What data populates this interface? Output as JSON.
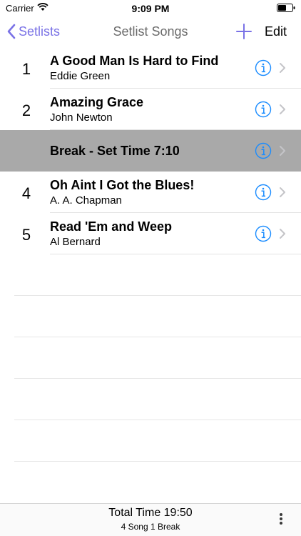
{
  "status_bar": {
    "carrier": "Carrier",
    "time": "9:09 PM"
  },
  "nav": {
    "back_label": "Setlists",
    "title": "Setlist Songs",
    "edit_label": "Edit"
  },
  "songs": [
    {
      "number": "1",
      "title": "A Good Man Is Hard to Find",
      "artist": "Eddie Green",
      "selected": false
    },
    {
      "number": "2",
      "title": "Amazing Grace",
      "artist": "John Newton",
      "selected": false
    },
    {
      "number": "",
      "title": "Break - Set Time 7:10",
      "artist": "",
      "selected": true
    },
    {
      "number": "4",
      "title": "Oh Aint I Got the Blues!",
      "artist": "A. A. Chapman",
      "selected": false
    },
    {
      "number": "5",
      "title": "Read 'Em and Weep",
      "artist": "Al Bernard",
      "selected": false
    }
  ],
  "footer": {
    "total_time": "Total Time 19:50",
    "summary": "4 Song 1 Break"
  },
  "colors": {
    "accent": "#7a72e6",
    "info_blue": "#1a8cff",
    "selected_row": "#a9a9a9"
  },
  "icons": [
    "wifi-icon",
    "battery-icon",
    "chevron-left-icon",
    "plus-icon",
    "info-icon",
    "chevron-right-icon",
    "more-vertical-icon"
  ]
}
